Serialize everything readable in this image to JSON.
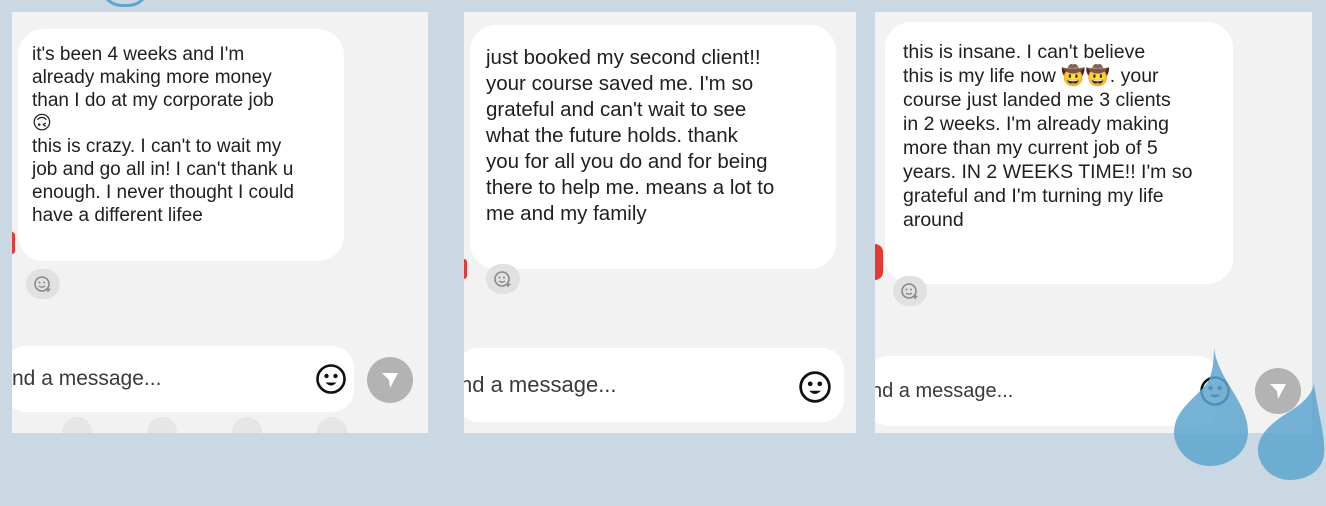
{
  "messages": [
    {
      "text": "it's been 4 weeks and I'm\nalready making more money\nthan I do at my corporate job\n🙃\nthis is crazy. I can't to wait my\njob and go all in! I can't thank u\nenough. I never thought I could\nhave a different lifee"
    },
    {
      "text": "just booked my second client!!\nyour course saved me. I'm so\ngrateful and can't wait to see\nwhat the future holds. thank\nyou for all you do and for being\nthere to help me. means a lot to\nme and my family"
    },
    {
      "text": "this is insane. I can't believe\nthis is my life now 🤠🤠. your\ncourse just landed me 3 clients\nin 2 weeks. I'm already making\nmore than my current job of 5\nyears. IN 2 WEEKS TIME!! I'm so\ngrateful and I'm turning my life\naround"
    }
  ],
  "composer": {
    "placeholder_1": "nd a message...",
    "placeholder_2": "nd a message...",
    "placeholder_3": "nd a message..."
  },
  "icons": {
    "reaction": "add-reaction-icon",
    "emoji": "emoji-icon",
    "send": "send-icon"
  },
  "colors": {
    "background": "#c9d8e2",
    "panel": "#f2f2f2",
    "bubble": "#ffffff",
    "send_button": "#b3b3b3",
    "decor_drop": "#5ea6cf"
  }
}
